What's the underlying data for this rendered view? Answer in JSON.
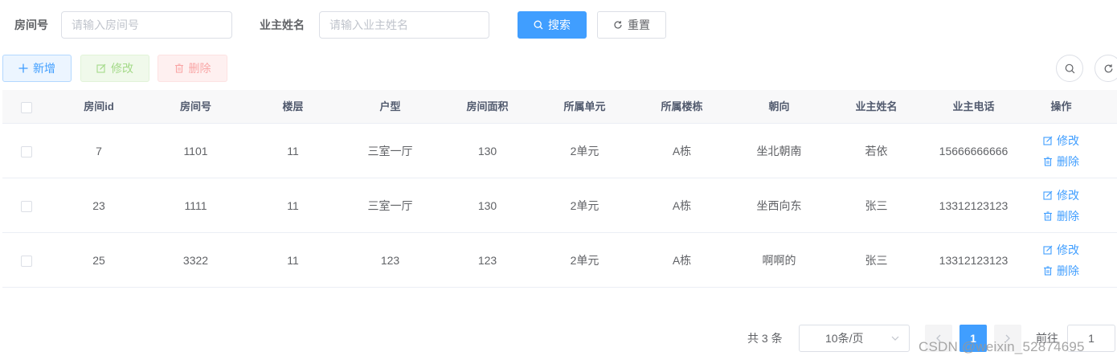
{
  "search": {
    "room_no_label": "房间号",
    "room_no_placeholder": "请输入房间号",
    "owner_name_label": "业主姓名",
    "owner_name_placeholder": "请输入业主姓名",
    "search_button": "搜索",
    "reset_button": "重置"
  },
  "toolbar": {
    "add_button": "新增",
    "edit_button": "修改",
    "delete_button": "删除"
  },
  "table": {
    "columns": [
      "房间id",
      "房间号",
      "楼层",
      "户型",
      "房间面积",
      "所属单元",
      "所属楼栋",
      "朝向",
      "业主姓名",
      "业主电话",
      "操作"
    ],
    "rows": [
      {
        "id": "7",
        "room_no": "1101",
        "floor": "11",
        "layout": "三室一厅",
        "area": "130",
        "unit": "2单元",
        "building": "A栋",
        "orientation": "坐北朝南",
        "owner": "若依",
        "phone": "15666666666"
      },
      {
        "id": "23",
        "room_no": "1111",
        "floor": "11",
        "layout": "三室一厅",
        "area": "130",
        "unit": "2单元",
        "building": "A栋",
        "orientation": "坐西向东",
        "owner": "张三",
        "phone": "13312123123"
      },
      {
        "id": "25",
        "room_no": "3322",
        "floor": "11",
        "layout": "123",
        "area": "123",
        "unit": "2单元",
        "building": "A栋",
        "orientation": "啊啊的",
        "owner": "张三",
        "phone": "13312123123"
      }
    ],
    "op_edit": "修改",
    "op_delete": "删除"
  },
  "pagination": {
    "total_text": "共 3 条",
    "page_size": "10条/页",
    "current_page": "1",
    "jump_label": "前往",
    "jump_value": "1"
  },
  "watermark": "CSDN @weixin_52874695",
  "colors": {
    "primary": "#409eff",
    "success_light": "#a4da89",
    "danger_light": "#f9a7a7",
    "header_bg": "#f8f8f9"
  }
}
